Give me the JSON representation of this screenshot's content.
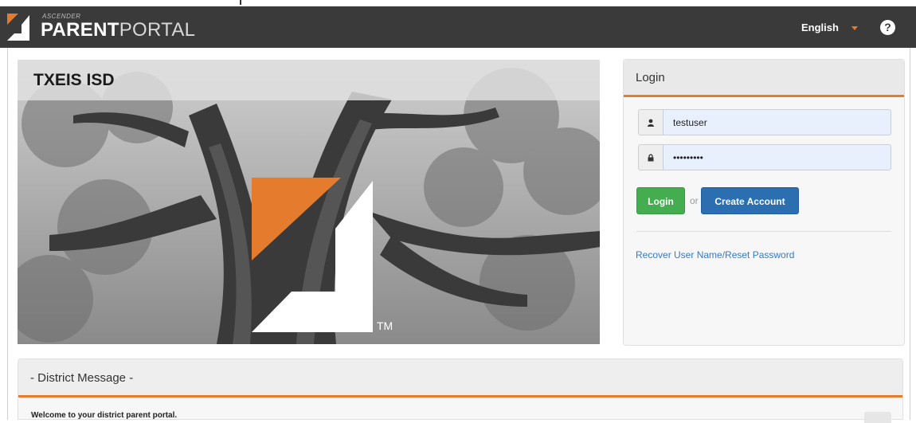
{
  "app": {
    "brand_small": "ASCENDER",
    "brand_bold": "PARENT",
    "brand_thin": "PORTAL"
  },
  "navbar": {
    "language": "English",
    "help_icon": "question-circle-icon",
    "help_glyph": "?"
  },
  "hero": {
    "district_name": "TXEIS ISD",
    "trademark": "TM"
  },
  "login": {
    "title": "Login",
    "username_value": "testuser",
    "password_value": "•••••••••",
    "user_icon": "user-icon",
    "lock_icon": "lock-icon",
    "login_button": "Login",
    "or_text": "or",
    "create_account_button": "Create Account",
    "recover_link": "Recover User Name/Reset Password"
  },
  "district_message": {
    "title": "- District Message -",
    "body": "Welcome to your district parent portal."
  },
  "colors": {
    "accent": "#e57c2d",
    "navbar": "#3a3a3a",
    "login_green": "#44ad4f",
    "create_blue": "#2b6fb0",
    "link_blue": "#3879c6"
  }
}
